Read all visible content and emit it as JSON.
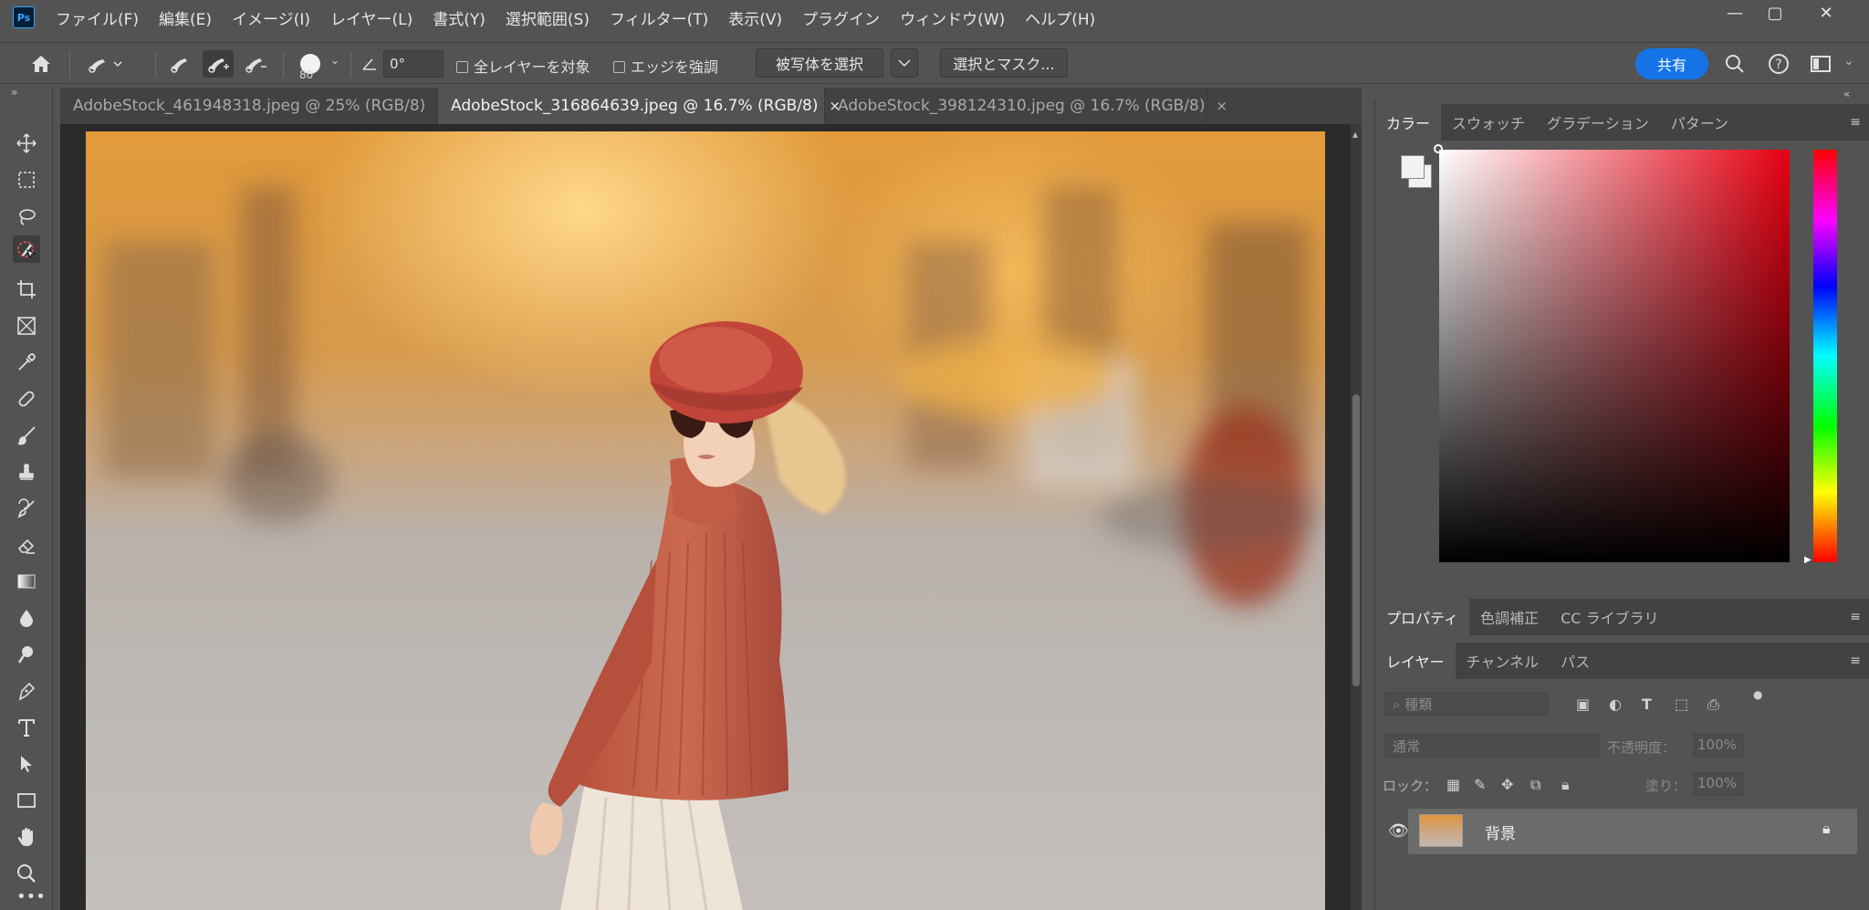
{
  "app": {
    "logo": "Ps"
  },
  "menu": [
    "ファイル(F)",
    "編集(E)",
    "イメージ(I)",
    "レイヤー(L)",
    "書式(Y)",
    "選択範囲(S)",
    "フィルター(T)",
    "表示(V)",
    "プラグイン",
    "ウィンドウ(W)",
    "ヘルプ(H)"
  ],
  "window_controls": {
    "minimize": "—",
    "maximize": "▢",
    "close": "✕"
  },
  "options": {
    "brush_size": "80",
    "angle": "0°",
    "sample_all_layers": "全レイヤーを対象",
    "enhance_edge": "エッジを強調",
    "select_subject": "被写体を選択",
    "select_and_mask": "選択とマスク...",
    "share": "共有"
  },
  "tabs": [
    {
      "label": "AdobeStock_461948318.jpeg @ 25% (RGB/8)",
      "close": "×"
    },
    {
      "label": "AdobeStock_316864639.jpeg @ 16.7% (RGB/8)",
      "close": "×"
    },
    {
      "label": "AdobeStock_398124310.jpeg @ 16.7% (RGB/8)",
      "close": "×"
    }
  ],
  "active_tab": 1,
  "color_panel": {
    "tabs": [
      "カラー",
      "スウォッチ",
      "グラデーション",
      "パターン"
    ],
    "foreground": "#f2f2f2",
    "background": "#f2f2f2"
  },
  "properties_panel": {
    "tabs": [
      "プロパティ",
      "色調補正",
      "CC ライブラリ"
    ]
  },
  "layers_panel": {
    "tabs": [
      "レイヤー",
      "チャンネル",
      "パス"
    ],
    "filter_placeholder": "種類",
    "blend_mode": "通常",
    "opacity_label": "不透明度：",
    "opacity_value": "100%",
    "lock_label": "ロック：",
    "fill_label": "塗り：",
    "fill_value": "100%",
    "layers": [
      {
        "name": "背景",
        "visible": true,
        "locked": true
      }
    ]
  },
  "colors": {
    "accent": "#1473e6",
    "ps_blue": "#31a8ff"
  }
}
